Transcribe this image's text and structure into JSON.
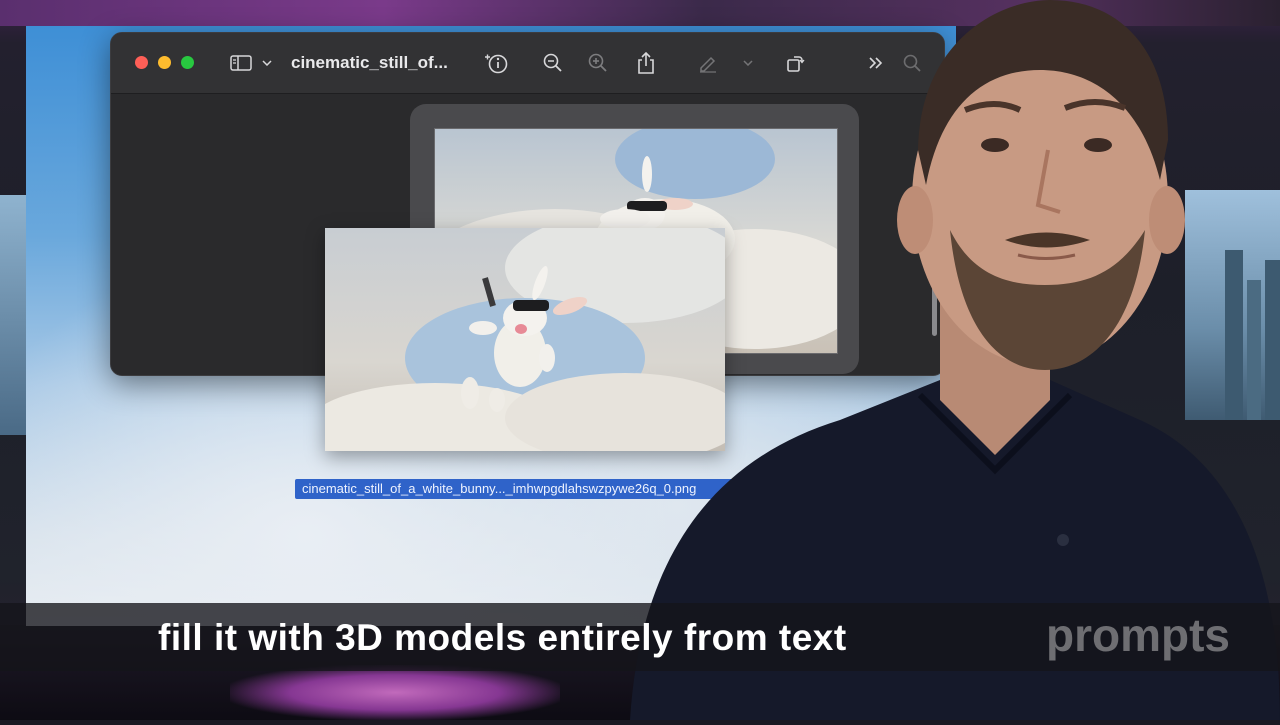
{
  "window": {
    "title": "cinematic_still_of..."
  },
  "toolbar": {
    "icons": [
      "sidebar-icon",
      "chevron-down-icon",
      "info-icon",
      "zoom-out-icon",
      "zoom-in-icon",
      "share-icon",
      "markup-pen-icon",
      "chevron-down-icon",
      "rotate-icon",
      "more-chevrons-icon",
      "search-icon"
    ]
  },
  "drag": {
    "filename": "cinematic_still_of_a_white_bunny..._imhwpgdlahswzpywe26q_0.png"
  },
  "subtitle": {
    "text": "fill it with 3D models entirely from text"
  },
  "watermark": {
    "text": "prompts"
  },
  "colors": {
    "selection": "#2f63c9",
    "traffic_red": "#fe5f57",
    "traffic_yellow": "#febc2e",
    "traffic_green": "#28c840"
  }
}
